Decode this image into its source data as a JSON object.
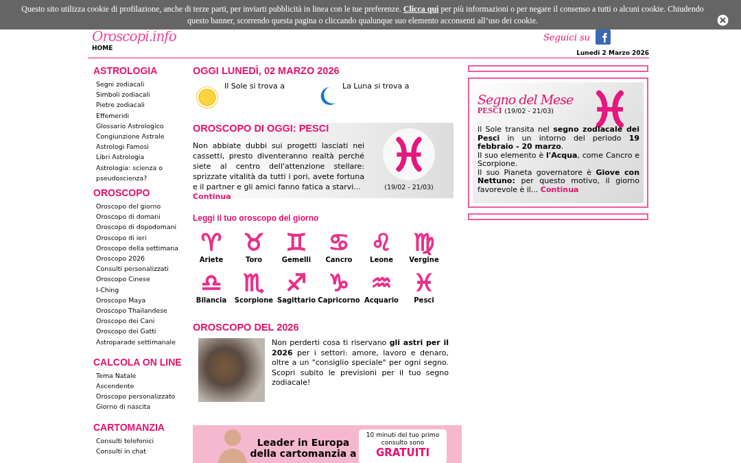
{
  "cookie_banner": {
    "text_before": "Questo sito utilizza cookie di profilazione, anche di terze parti, per inviarti pubblicità in linea con le tue preferenze.",
    "link": "Clicca qui",
    "text_after": "per più informazioni o per negare il consenso a tutti o alcuni cookie. Chiudendo questo banner, scorrendo questa pagina o cliccando qualunque suo elemento acconsenti all’uso dei cookie."
  },
  "header": {
    "logo": "Oroscopi.info",
    "follow_label": "Seguici su",
    "nav": [
      "HOME"
    ],
    "date": "Lunedi 2 Marzo 2026"
  },
  "sidebar": {
    "sections": [
      {
        "title": "ASTROLOGIA",
        "items": [
          "Segni zodiacali",
          "Simboli zodiacali",
          "Pietre zodiacali",
          "Effemeridi",
          "Glossario Astrologico",
          "Congiunzione Astrale",
          "Astrologi Famosi",
          "Libri Astrologia",
          "Astrologia: scienza o pseudoscienza?"
        ]
      },
      {
        "title": "OROSCOPO",
        "items": [
          "Oroscopo del giorno",
          "Oroscopo di domani",
          "Oroscopo di dopodomani",
          "Oroscopo di ieri",
          "Oroscopo della settimana",
          "Oroscopo 2026",
          "Consulti personalizzati",
          "Oroscopo Cinese",
          "I-Ching",
          "Oroscopo Maya",
          "Oroscopo Thailandese",
          "Oroscopo dei Cani",
          "Oroscopo dei Gatti",
          "Astroparade settimanale"
        ]
      },
      {
        "title": "CALCOLA ON LINE",
        "items": [
          "Tema Natale",
          "Ascendente",
          "Oroscopo personalizzato",
          "Giorno di nascita"
        ]
      },
      {
        "title": "CARTOMANZIA",
        "items": [
          "Consulti telefonici",
          "Consulti in chat"
        ]
      }
    ]
  },
  "today": {
    "title": "OGGI LUNEDÌ, 02 MARZO 2026",
    "sun_text": "Il Sole si trova a",
    "moon_text": "La Luna si trova a"
  },
  "horoscope_today": {
    "title": "OROSCOPO DI OGGI: PESCI",
    "text": "Non abbiate dubbi sui progetti lasciati nei cassetti, presto diventeranno realtà perché siete al centro dell'attenzione stellare: sprizzate vitalità da tutti i pori, avete fortuna e il partner e gli amici fanno fatica a starvi...",
    "link": "Continua",
    "range": "(19/02 - 21/03)"
  },
  "signs": {
    "title": "Leggi il tuo oroscopo del giorno",
    "items": [
      {
        "symbol": "♈",
        "name": "Ariete"
      },
      {
        "symbol": "♉",
        "name": "Toro"
      },
      {
        "symbol": "♊",
        "name": "Gemelli"
      },
      {
        "symbol": "♋",
        "name": "Cancro"
      },
      {
        "symbol": "♌",
        "name": "Leone"
      },
      {
        "symbol": "♍",
        "name": "Vergine"
      },
      {
        "symbol": "♎",
        "name": "Bilancia"
      },
      {
        "symbol": "♏",
        "name": "Scorpione"
      },
      {
        "symbol": "♐",
        "name": "Sagittario"
      },
      {
        "symbol": "♑",
        "name": "Capricorno"
      },
      {
        "symbol": "♒",
        "name": "Acquario"
      },
      {
        "symbol": "♓",
        "name": "Pesci"
      }
    ]
  },
  "year": {
    "title": "OROSCOPO DEL 2026",
    "text": "Non perderti cosa ti riservano **gli astri per il 2026** per i settori: amore, lavoro e denaro, oltre a un \"consiglio speciale\" per ogni segno. Scopri subito le previsioni per il tuo segno zodiacale!"
  },
  "ad": {
    "headline": [
      "Leader in Europa",
      "della cartomanzia a"
    ],
    "offer_text": "10 minuti del tuo primo consulto sono",
    "offer_highlight": "GRATUITI"
  },
  "sign_of_month": {
    "title": "Segno del Mese",
    "sign": "PESCI",
    "range": "(19/02 - 21/03)",
    "paragraphs": [
      "Il Sole transita nel **segno zodiacale dei Pesci** in un intorno del periodo **19 febbraio - 20 marzo**.",
      "Il suo elemento è **l'Acqua**, come Cancro e Scorpione.",
      "Il suo Pianeta governatore è **Giove con Nettuno:** per questo motivo, il giorno favorevole è il..."
    ],
    "link": "Continua"
  }
}
